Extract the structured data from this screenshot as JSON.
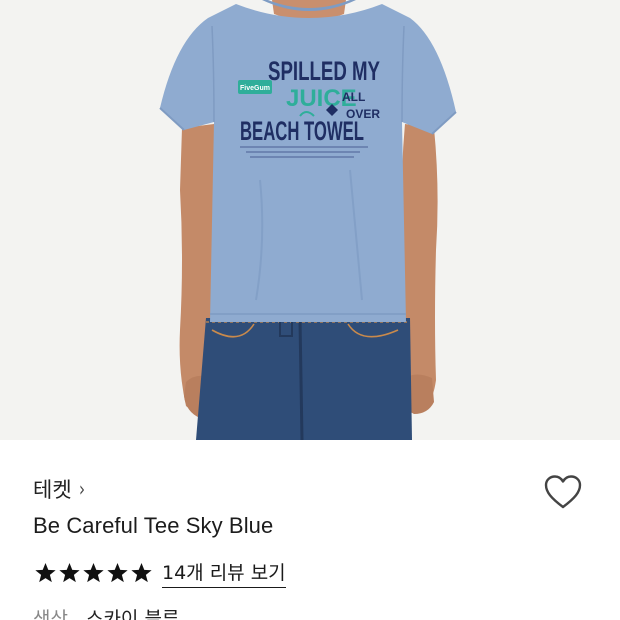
{
  "product": {
    "brand": "테켓",
    "brand_chevron": "›",
    "name": "Be Careful Tee Sky Blue",
    "rating_stars": 5,
    "review_link": "14개 리뷰 보기",
    "color_label": "색상",
    "color_value": "스카이 블루"
  },
  "icons": {
    "wishlist": "heart-outline-icon",
    "star": "star-filled-icon",
    "chevron": "chevron-right-icon"
  },
  "shirt_print": {
    "line1": "SPILLED MY",
    "line2": "JUICE",
    "line3": "ALL",
    "line4": "OVER",
    "line5": "BEACH TOWEL",
    "tag": "FiveGum"
  },
  "colors": {
    "shirt": "#8fabd0",
    "print_navy": "#1f2e63",
    "print_teal": "#2fae9a",
    "jeans": "#2f4d78",
    "skin": "#c98f6e",
    "background": "#f3f3f1",
    "star": "#111111"
  }
}
